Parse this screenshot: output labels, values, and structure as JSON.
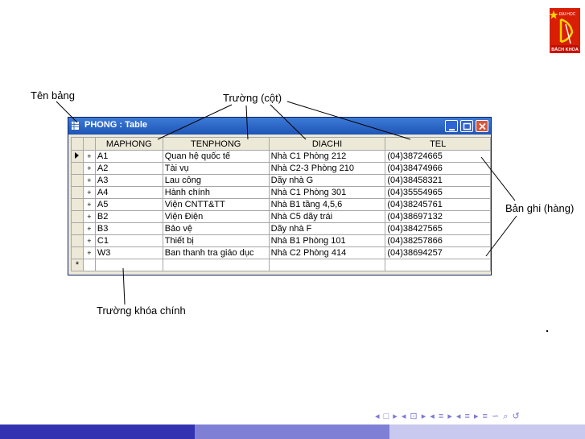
{
  "logo": {
    "text_top": "ĐẠI HỌC",
    "text_bottom": "BÁCH KHOA"
  },
  "annotations": {
    "table_name": "Tên bảng",
    "field": "Trường (cột)",
    "record": "Bản ghi (hàng)",
    "primary_key": "Trường khóa chính"
  },
  "window": {
    "title": "PHONG : Table",
    "columns": [
      "MAPHONG",
      "TENPHONG",
      "DIACHI",
      "TEL"
    ],
    "rows": [
      [
        "A1",
        "Quan hệ quốc tế",
        "Nhà C1 Phòng 212",
        "(04)38724665"
      ],
      [
        "A2",
        "Tài vụ",
        "Nhà C2-3 Phòng 210",
        "(04)38474966"
      ],
      [
        "A3",
        "Lau công",
        "Dãy nhà G",
        "(04)38458321"
      ],
      [
        "A4",
        "Hành chính",
        "Nhà C1 Phòng 301",
        "(04)35554965"
      ],
      [
        "A5",
        "Viện CNTT&TT",
        "Nhà B1 tầng 4,5,6",
        "(04)38245761"
      ],
      [
        "B2",
        "Viện Điện",
        "Nhà C5 dãy trái",
        "(04)38697132"
      ],
      [
        "B3",
        "Bảo vệ",
        "Dãy nhà F",
        "(04)38427565"
      ],
      [
        "C1",
        "Thiết bị",
        "Nhà B1 Phòng 101",
        "(04)38257866"
      ],
      [
        "W3",
        "Ban thanh tra giáo dục",
        "Nhà C2 Phòng 414",
        "(04)38694257"
      ]
    ],
    "expander_symbol": "+",
    "new_row_symbol": "*"
  },
  "footer": {
    "nav_symbols": "◂ □ ▸ ◂ ⊡ ▸ ◂ ≡ ▸ ◂ ≡ ▸ ≡ ∽ ⌕ ↺"
  },
  "colors": {
    "titlebar": "#1f55b7",
    "footer_dark": "#3333b2",
    "footer_mid": "#7f7fd6",
    "footer_light": "#c9c9ef",
    "logo_red": "#d81e05"
  }
}
